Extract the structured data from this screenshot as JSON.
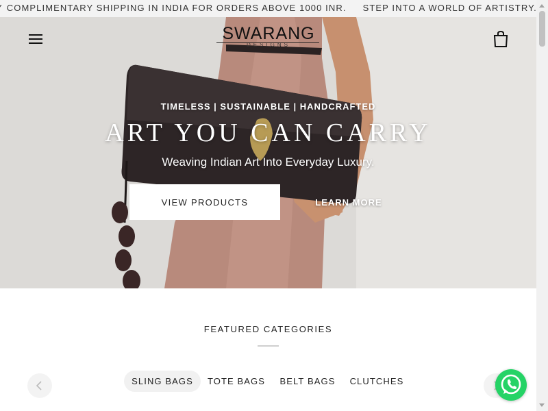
{
  "announcement": {
    "messages": [
      "COMPLIMENTARY SHIPPING IN INDIA FOR ORDERS ABOVE 1000 INR.",
      "STEP INTO A WORLD OF ARTISTRY. ENJOY COMP"
    ],
    "lead": "Y"
  },
  "header": {
    "logo_main": "SWARANG",
    "logo_sub": "DESIGNS",
    "menu_icon": "hamburger-menu-icon",
    "cart_icon": "shopping-bag-icon"
  },
  "hero": {
    "tagline": "TIMELESS | SUSTAINABLE | HANDCRAFTED",
    "headline": "ART YOU CAN CARRY",
    "subheadline": "Weaving Indian Art Into Everyday Luxury.",
    "primary_button": "VIEW PRODUCTS",
    "secondary_button": "LEARN MORE"
  },
  "featured": {
    "title": "FEATURED CATEGORIES",
    "categories": [
      "SLING BAGS",
      "TOTE BAGS",
      "BELT BAGS",
      "CLUTCHES"
    ],
    "active_index": 0,
    "prev_icon": "chevron-left-icon",
    "next_icon": "chevron-right-icon"
  },
  "chat": {
    "icon": "whatsapp-icon",
    "color": "#25d366"
  }
}
